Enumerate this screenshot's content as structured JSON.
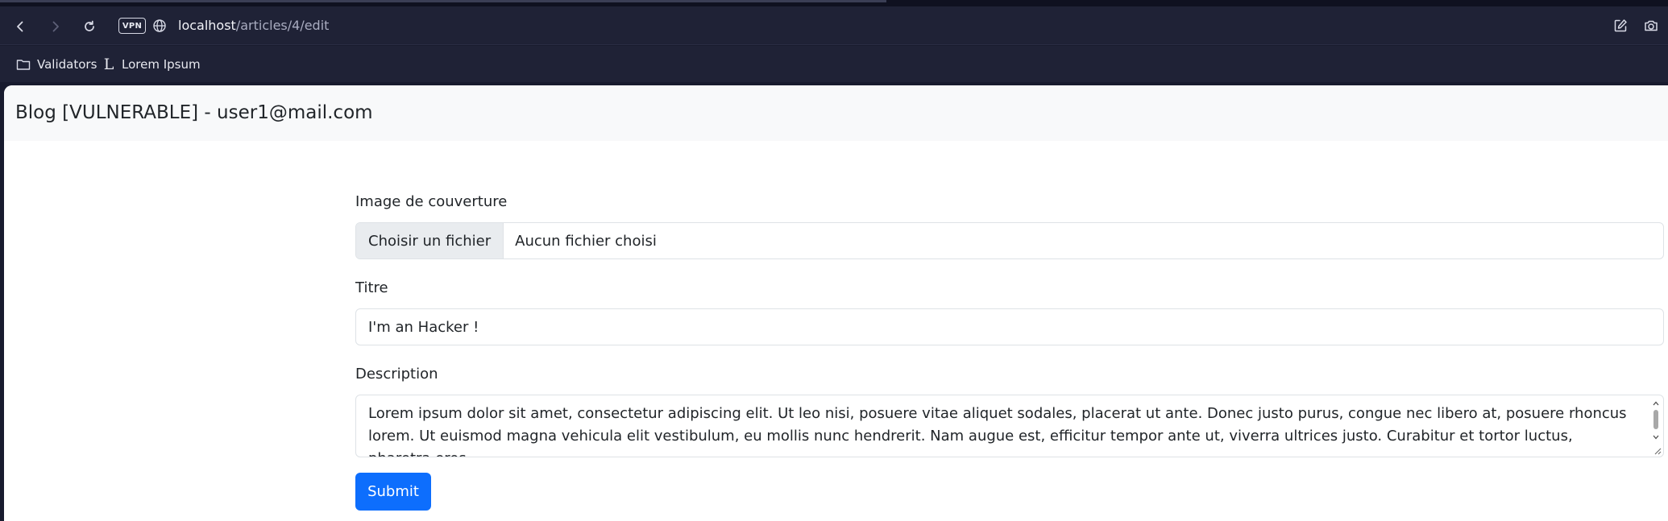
{
  "browser": {
    "vpn_label": "VPN",
    "url_host": "localhost",
    "url_path": "/articles/4/edit",
    "icons": [
      "back-icon",
      "forward-icon",
      "reload-icon",
      "globe-icon",
      "edit-icon",
      "camera-icon"
    ]
  },
  "bookmarks": {
    "items": [
      {
        "label": "Validators",
        "icon": "folder-icon"
      },
      {
        "label": "Lorem Ipsum",
        "icon": "lorem-ipsum-icon",
        "glyph": "L"
      }
    ]
  },
  "page": {
    "brand": "Blog [VULNERABLE] - user1@mail.com",
    "form": {
      "cover_label": "Image de couverture",
      "file_button": "Choisir un fichier",
      "file_status": "Aucun fichier choisi",
      "title_label": "Titre",
      "title_value": "I'm an Hacker !",
      "description_label": "Description",
      "description_value": "Lorem ipsum dolor sit amet, consectetur adipiscing elit. Ut leo nisi, posuere vitae aliquet sodales, placerat ut ante. Donec justo purus, congue nec libero at, posuere rhoncus lorem. Ut euismod magna vehicula elit vestibulum, eu mollis nunc hendrerit. Nam augue est, efficitur tempor ante ut, viverra ultrices justo. Curabitur et tortor luctus, pharetra eros",
      "submit_label": "Submit"
    }
  },
  "colors": {
    "primary": "#0d6efd",
    "navbar_bg": "#f8f9fa",
    "chrome_bg": "#1f2236"
  }
}
